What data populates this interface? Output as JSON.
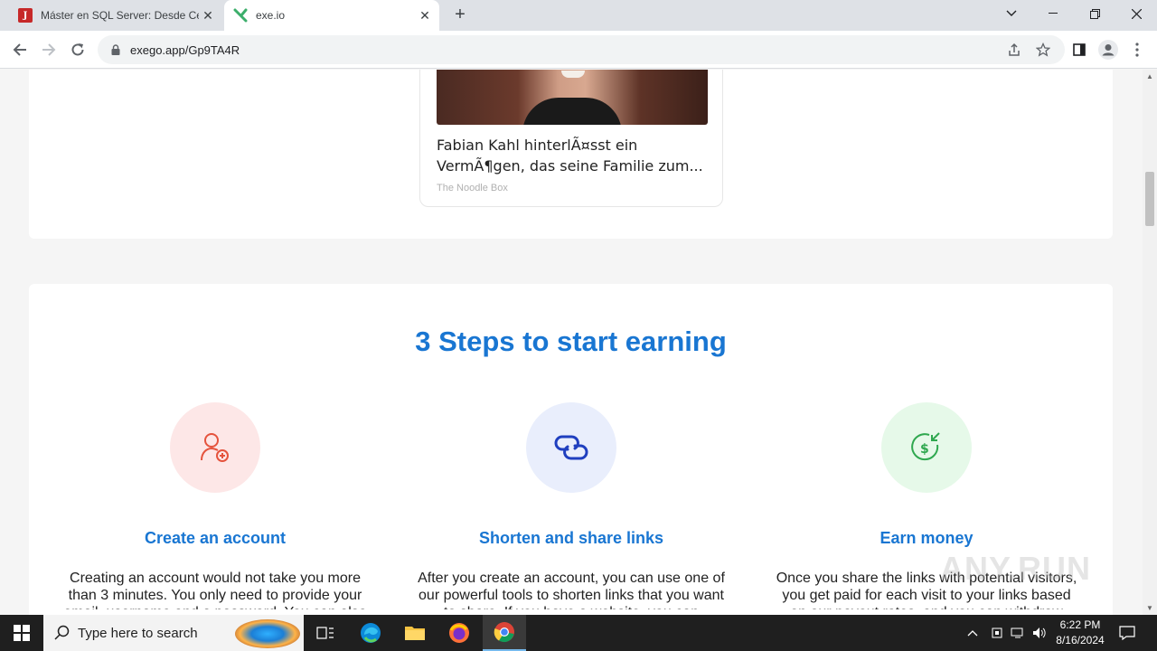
{
  "browser": {
    "tabs": [
      {
        "title": "Máster en SQL Server: Desde Cer",
        "favicon": "J"
      },
      {
        "title": "exe.io"
      }
    ],
    "url": "exego.app/Gp9TA4R"
  },
  "ad": {
    "headline_line1": "Fabian Kahl hinterlÃ¤sst ein",
    "headline_line2": "VermÃ¶gen, das seine Familie zum...",
    "source": "The Noodle Box"
  },
  "steps": {
    "title": "3 Steps to start earning",
    "items": [
      {
        "title": "Create an account",
        "desc": "Creating an account would not take you more than 3 minutes. You only need to provide your email, username and a password. You can also",
        "color": "#fde7e7",
        "icon": "add-user-icon"
      },
      {
        "title": "Shorten and share links",
        "desc": "After you create an account, you can use one of our powerful tools to shorten links that you want to share. If you have a website, you can",
        "color": "#e9eefc",
        "icon": "link-icon"
      },
      {
        "title": "Earn money",
        "desc": "Once you share the links with potential visitors, you get paid for each visit to your links based on our payout rates, and you can withdraw",
        "color": "#e6f9e9",
        "icon": "money-icon"
      }
    ]
  },
  "watermark": "ANY.RUN",
  "taskbar": {
    "search_placeholder": "Type here to search",
    "time": "6:22 PM",
    "date": "8/16/2024"
  }
}
